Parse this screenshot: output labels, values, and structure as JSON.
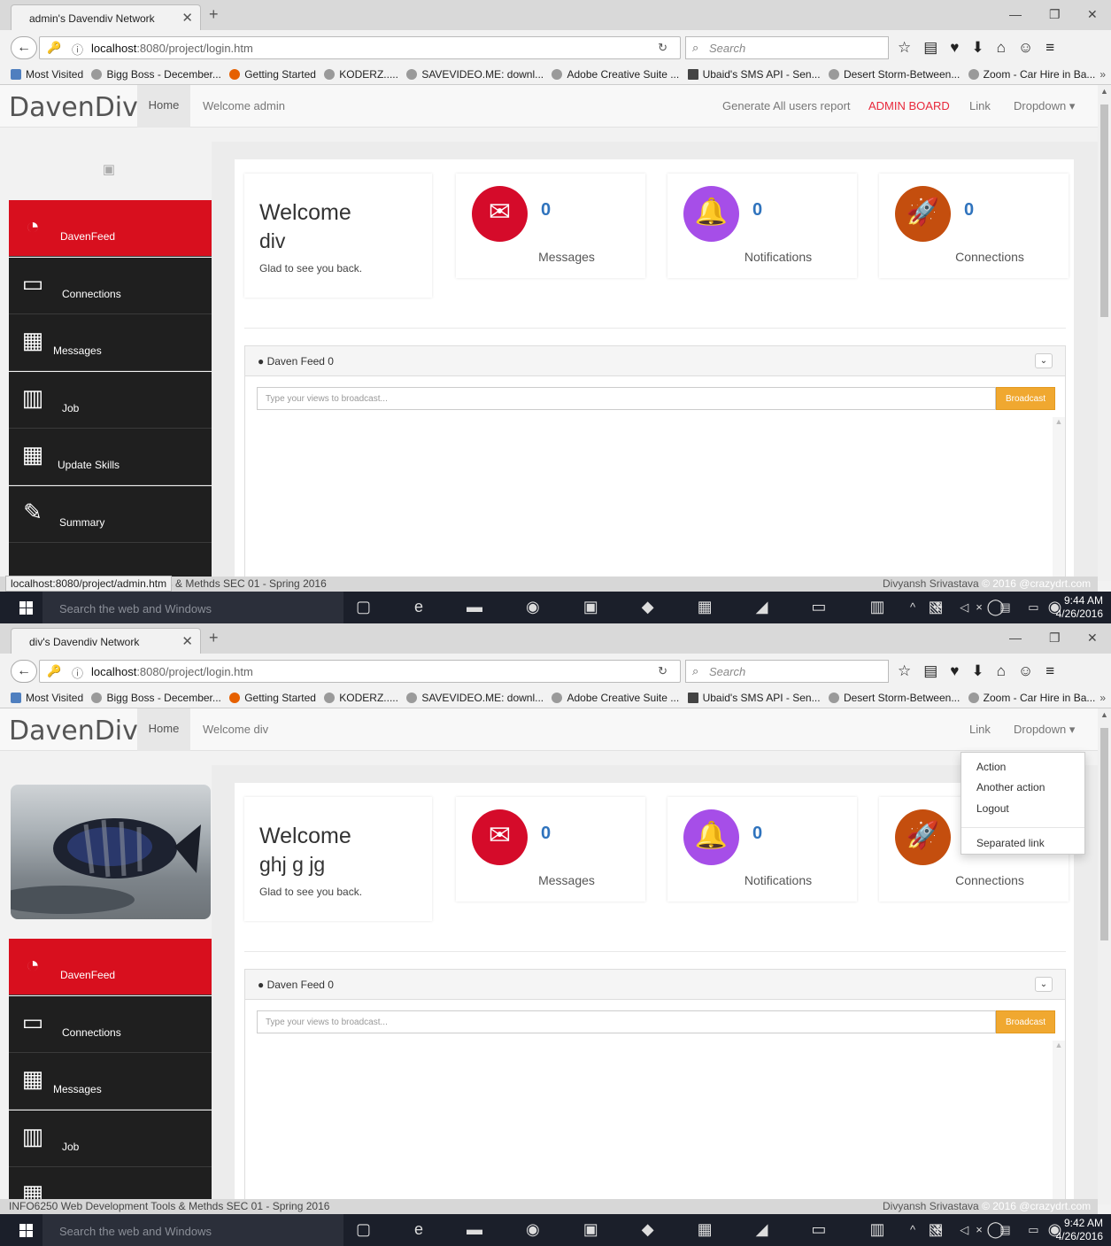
{
  "shots": [
    {
      "tab_title": "admin's Davendiv Network",
      "url_host": "localhost",
      "url_rest": ":8080/project/login.htm",
      "search_placeholder": "Search",
      "bookmarks": [
        "Most Visited",
        "Bigg Boss - December...",
        "Getting Started",
        "KODERZ.....",
        "SAVEVIDEO.ME: downl...",
        "Adobe Creative Suite ...",
        "Ubaid's SMS API - Sen...",
        "Desert Storm-Between...",
        "Zoom - Car Hire in Ba..."
      ],
      "brand": "DavenDiv",
      "nav_home": "Home",
      "nav_welcome": "Welcome admin",
      "nav_right": [
        "Generate All users report",
        "ADMIN BOARD",
        "Link",
        "Dropdown ▾"
      ],
      "welcome_title": "Welcome",
      "welcome_name": "div",
      "welcome_sub": "Glad to see you back.",
      "stats": [
        {
          "value": "0",
          "label": "Messages",
          "color": "#d50b2a",
          "icon": "envelope-icon"
        },
        {
          "value": "0",
          "label": "Notifications",
          "color": "#a64ee8",
          "icon": "bell-icon"
        },
        {
          "value": "0",
          "label": "Connections",
          "color": "#c44e0e",
          "icon": "rocket-icon"
        }
      ],
      "sidebar": [
        "DavenFeed",
        "Connections",
        "Messages",
        "Job",
        "Update Skills",
        "Summary"
      ],
      "feed_title": "Daven Feed 0",
      "broadcast_placeholder": "Type your views to broadcast...",
      "broadcast_button": "Broadcast",
      "status_url": "localhost:8080/project/admin.htm",
      "status_left": "ls & Methds SEC 01 - Spring 2016",
      "status_author": "Divyansh Srivastava",
      "status_copy": "© 2016 @crazydrt.com",
      "taskbar_search": "Search the web and Windows",
      "clock_time": "9:44 AM",
      "clock_date": "4/26/2016"
    },
    {
      "tab_title": "div's Davendiv Network",
      "url_host": "localhost",
      "url_rest": ":8080/project/login.htm",
      "search_placeholder": "Search",
      "bookmarks": [
        "Most Visited",
        "Bigg Boss - December...",
        "Getting Started",
        "KODERZ.....",
        "SAVEVIDEO.ME: downl...",
        "Adobe Creative Suite ...",
        "Ubaid's SMS API - Sen...",
        "Desert Storm-Between...",
        "Zoom - Car Hire in Ba..."
      ],
      "brand": "DavenDiv",
      "nav_home": "Home",
      "nav_welcome": "Welcome div",
      "nav_right": [
        "Link",
        "Dropdown ▾"
      ],
      "dropdown_items": [
        "Action",
        "Another action",
        "Logout",
        "Separated link"
      ],
      "welcome_title": "Welcome",
      "welcome_name": "ghj g jg",
      "welcome_sub": "Glad to see you back.",
      "stats": [
        {
          "value": "0",
          "label": "Messages",
          "color": "#d50b2a",
          "icon": "envelope-icon"
        },
        {
          "value": "0",
          "label": "Notifications",
          "color": "#a64ee8",
          "icon": "bell-icon"
        },
        {
          "value": "",
          "label": "Connections",
          "color": "#c44e0e",
          "icon": "rocket-icon"
        }
      ],
      "sidebar": [
        "DavenFeed",
        "Connections",
        "Messages",
        "Job"
      ],
      "feed_title": "Daven Feed 0",
      "broadcast_placeholder": "Type your views to broadcast...",
      "broadcast_button": "Broadcast",
      "status_left": "INFO6250 Web Development Tools & Methds SEC 01 - Spring 2016",
      "status_author": "Divyansh Srivastava",
      "status_copy": "© 2016 @crazydrt.com",
      "taskbar_search": "Search the web and Windows",
      "clock_time": "9:42 AM",
      "clock_date": "4/26/2016"
    }
  ]
}
